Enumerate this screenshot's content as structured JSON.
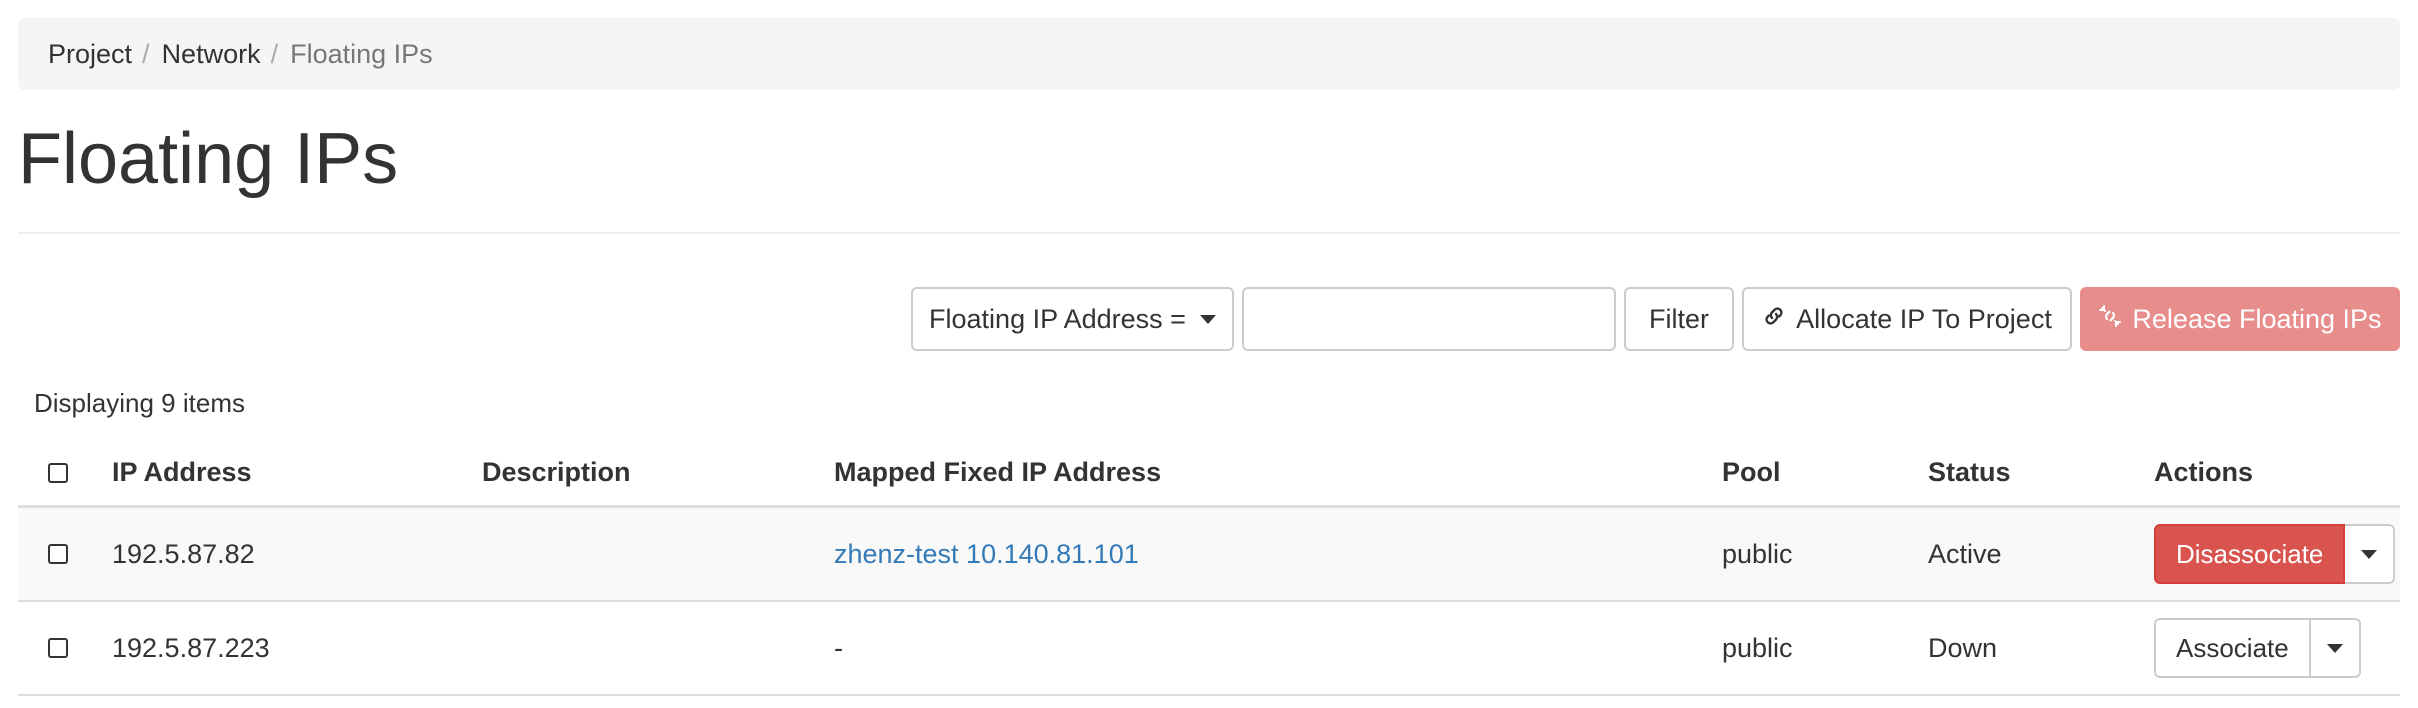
{
  "breadcrumb": {
    "items": [
      "Project",
      "Network",
      "Floating IPs"
    ],
    "separator": "/"
  },
  "page": {
    "title": "Floating IPs"
  },
  "toolbar": {
    "filter_field_label": "Floating IP Address =",
    "filter_input_value": "",
    "filter_button": "Filter",
    "allocate_button": "Allocate IP To Project",
    "release_button": "Release Floating IPs"
  },
  "table": {
    "count_label": "Displaying 9 items",
    "columns": [
      "IP Address",
      "Description",
      "Mapped Fixed IP Address",
      "Pool",
      "Status",
      "Actions"
    ],
    "rows": [
      {
        "ip": "192.5.87.82",
        "description": "",
        "mapped": "zhenz-test 10.140.81.101",
        "pool": "public",
        "status": "Active",
        "action": "Disassociate"
      },
      {
        "ip": "192.5.87.223",
        "description": "",
        "mapped": "-",
        "pool": "public",
        "status": "Down",
        "action": "Associate"
      }
    ]
  },
  "colors": {
    "link": "#337ab7",
    "danger": "#d9534f",
    "danger_disabled": "#e78d8b"
  },
  "icons": {
    "allocate": "link-icon",
    "release": "unlink-icon",
    "dropdown": "caret-down-icon"
  }
}
